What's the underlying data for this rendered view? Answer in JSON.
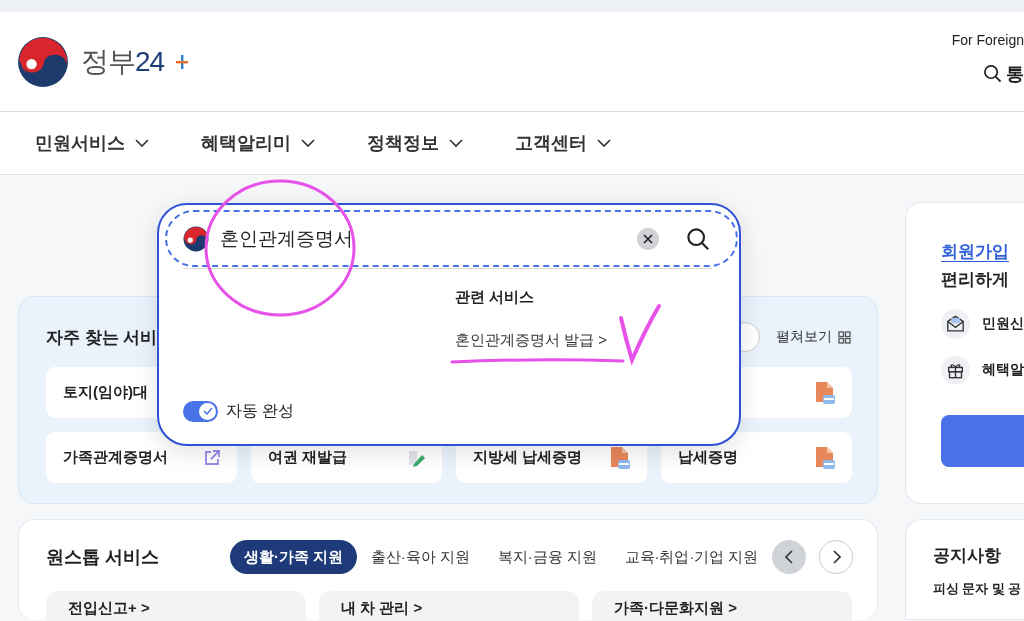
{
  "header": {
    "logo_text": "정부",
    "logo_number": "24",
    "for_foreigners": "For Foreign",
    "search_label": "통"
  },
  "nav": [
    {
      "label": "민원서비스"
    },
    {
      "label": "혜택알리미"
    },
    {
      "label": "정책정보"
    },
    {
      "label": "고객센터"
    }
  ],
  "frequent": {
    "title": "자주 찾는 서비",
    "expand": "펼쳐보기",
    "rows": [
      [
        {
          "label": "토지(임야)대"
        },
        {
          "kind": "pdf"
        }
      ],
      [
        {
          "label": "가족관계증명서",
          "kind": "link"
        },
        {
          "label": "여권 재발급",
          "kind": "edit"
        },
        {
          "label": "지방세 납세증명",
          "kind": "pdf"
        },
        {
          "label": "납세증명",
          "kind": "pdf"
        }
      ]
    ]
  },
  "onestop": {
    "title": "원스톱 서비스",
    "tabs": [
      {
        "label": "생활·가족 지원",
        "selected": true
      },
      {
        "label": "출산·육아 지원",
        "selected": false
      },
      {
        "label": "복지·금융 지원",
        "selected": false
      },
      {
        "label": "교육·취업·기업 지원",
        "selected": false
      }
    ],
    "prev": {
      "disabled": true
    },
    "next": {
      "disabled": false
    },
    "cards": [
      {
        "label": "전입신고+ >"
      },
      {
        "label": "내 차 관리 >"
      },
      {
        "label": "가족·다문화지원 >"
      }
    ]
  },
  "member": {
    "link": "회원가입",
    "subtitle": "편리하게",
    "items": [
      {
        "kind": "mail",
        "label": "민원신"
      },
      {
        "kind": "gift",
        "label": "혜택알"
      }
    ]
  },
  "notice": {
    "title": "공지사항",
    "item": "피싱 문자 및 공"
  },
  "search_popup": {
    "query": "혼인관계증명서",
    "related_title": "관련 서비스",
    "related": [
      {
        "label": "혼인관계증명서 발급 >"
      }
    ],
    "autocomplete": {
      "label": "자동 완성",
      "on": true
    }
  },
  "annotations": [
    {
      "kind": "circle"
    },
    {
      "kind": "check"
    },
    {
      "kind": "underline"
    }
  ]
}
